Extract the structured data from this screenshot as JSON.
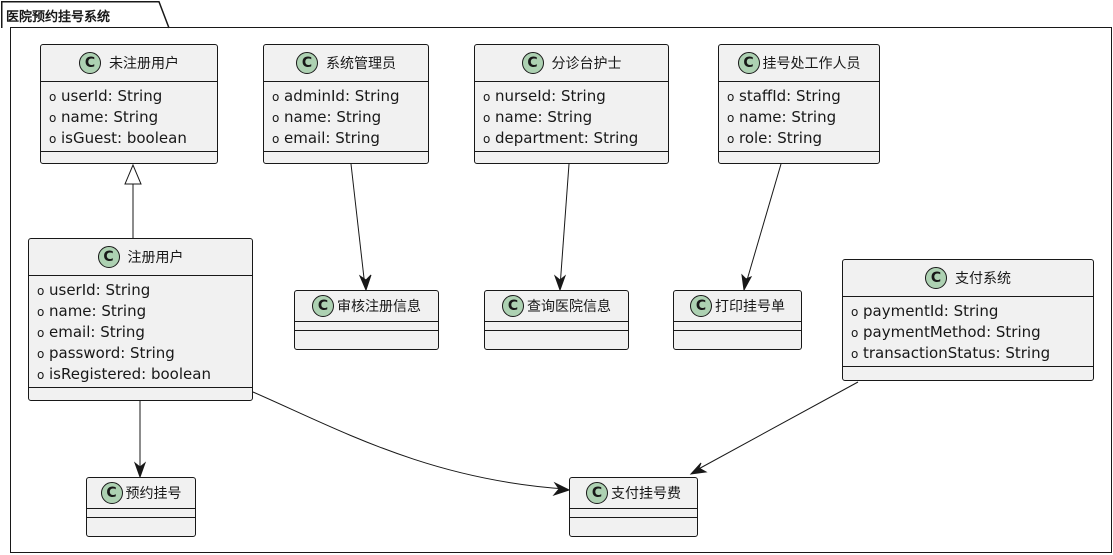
{
  "package": {
    "title": "医院预约挂号系统"
  },
  "classes": {
    "unregistered_user": {
      "name": "未注册用户",
      "icon": "class-c-icon",
      "attributes": [
        "userId: String",
        "name: String",
        "isGuest: boolean"
      ]
    },
    "system_admin": {
      "name": "系统管理员",
      "icon": "class-c-icon",
      "attributes": [
        "adminId: String",
        "name: String",
        "email: String"
      ]
    },
    "triage_nurse": {
      "name": "分诊台护士",
      "icon": "class-c-icon",
      "attributes": [
        "nurseId: String",
        "name: String",
        "department: String"
      ]
    },
    "registration_staff": {
      "name": "挂号处工作人员",
      "icon": "class-c-icon",
      "attributes": [
        "staffId: String",
        "name: String",
        "role: String"
      ]
    },
    "registered_user": {
      "name": "注册用户",
      "icon": "class-c-icon",
      "attributes": [
        "userId: String",
        "name: String",
        "email: String",
        "password: String",
        "isRegistered: boolean"
      ]
    },
    "payment_system": {
      "name": "支付系统",
      "icon": "class-c-icon",
      "attributes": [
        "paymentId: String",
        "paymentMethod: String",
        "transactionStatus: String"
      ]
    },
    "review_registration": {
      "name": "审核注册信息",
      "icon": "class-c-icon",
      "attributes": []
    },
    "query_hospital_info": {
      "name": "查询医院信息",
      "icon": "class-c-icon",
      "attributes": []
    },
    "print_registration_slip": {
      "name": "打印挂号单",
      "icon": "class-c-icon",
      "attributes": []
    },
    "book_appointment": {
      "name": "预约挂号",
      "icon": "class-c-icon",
      "attributes": []
    },
    "pay_registration_fee": {
      "name": "支付挂号费",
      "icon": "class-c-icon",
      "attributes": []
    }
  },
  "symbols": {
    "class_circle": "C",
    "public_visibility": "o"
  },
  "relations": [
    {
      "from": "registered_user",
      "to": "unregistered_user",
      "type": "generalization"
    },
    {
      "from": "system_admin",
      "to": "review_registration",
      "type": "association"
    },
    {
      "from": "triage_nurse",
      "to": "query_hospital_info",
      "type": "association"
    },
    {
      "from": "registration_staff",
      "to": "print_registration_slip",
      "type": "association"
    },
    {
      "from": "registered_user",
      "to": "book_appointment",
      "type": "association"
    },
    {
      "from": "registered_user",
      "to": "pay_registration_fee",
      "type": "association"
    },
    {
      "from": "payment_system",
      "to": "pay_registration_fee",
      "type": "association"
    }
  ],
  "colors": {
    "class_fill": "#f1f1f1",
    "stereotype_circle": "#add1b2",
    "line": "#181818"
  }
}
